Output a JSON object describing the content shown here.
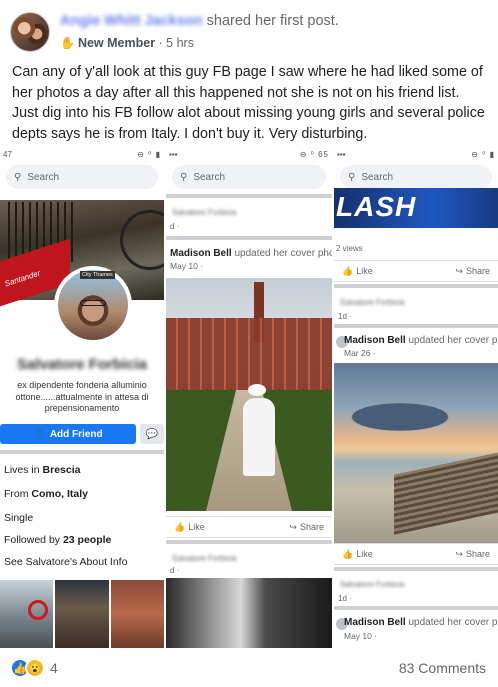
{
  "post": {
    "author_name": "Angie Whitt Jackson",
    "action": "shared her first post.",
    "badge": "New Member",
    "time": "· 5 hrs",
    "text": "Can any of y'all look at this guy FB page I saw where he had liked some of her photos a day after all this happened not she is not on his friend list. Just dig into his FB follow alot about missing young girls and several police depts says he is from Italy. I don't buy it. Very disturbing."
  },
  "screens": {
    "status_left_1": "47",
    "status_left_2": "",
    "status_left_3": "",
    "status_right_2": "65",
    "search_placeholder": "Search"
  },
  "profile": {
    "name": "Salvatore Forbicia",
    "cover_text": "Santander",
    "pp_tag": "City Thames",
    "bio": "ex dipendente fonderia alluminio ottone......attualmente in attesa di prepensionamento",
    "add_friend": "Add Friend",
    "lives_label": "Lives in",
    "lives_value": "Brescia",
    "from_label": "From",
    "from_value": "Como, Italy",
    "relationship": "Single",
    "followed_label": "Followed by",
    "followed_value": "23 people",
    "about_link": "See Salvatore's About Info"
  },
  "feed_middle": {
    "top_blur": "Salvatore Forbicia",
    "top_time": "d ·",
    "update_name": "Madison Bell",
    "update_text": "updated her cover photo.",
    "date": "May 10 ·",
    "like": "Like",
    "share": "Share",
    "bottom_blur": "Salvatore Forbicia",
    "bottom_time": "d ·"
  },
  "feed_right": {
    "banner": "LASH",
    "views": "2 views",
    "like": "Like",
    "share": "Share",
    "top_blur": "Salvatore Forbicia",
    "top_time": "1d ·",
    "update_name": "Madison Bell",
    "update_text": "updated her cover photo.",
    "date": "Mar 26 ·",
    "like2": "Like",
    "share2": "Share",
    "bottom_blur": "Salvatore Forbicia",
    "bottom_time": "1d ·",
    "update_name2": "Madison Bell",
    "update_text2": "updated her cover photo.",
    "date2": "May 10 ·"
  },
  "footer": {
    "reaction_count": "4",
    "comments": "83 Comments"
  },
  "colors": {
    "fb_blue": "#1877f2",
    "muted": "#65676b"
  }
}
